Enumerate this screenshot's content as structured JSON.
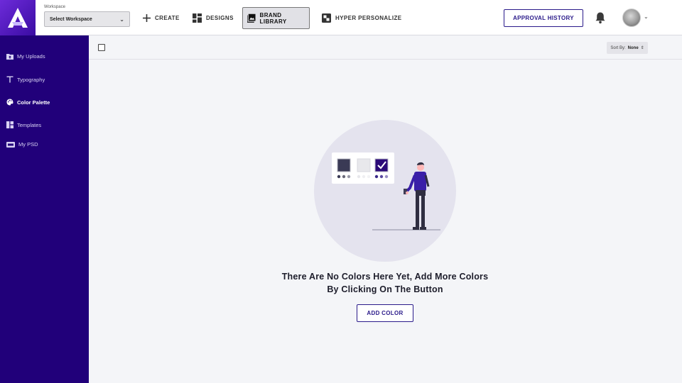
{
  "header": {
    "workspace_label": "Workspace",
    "workspace_value": "Select Workspace",
    "nav": [
      {
        "label": "CREATE",
        "icon": "plus-icon"
      },
      {
        "label": "DESIGNS",
        "icon": "grid-icon"
      },
      {
        "label": "BRAND LIBRARY",
        "icon": "image-icon",
        "active": true
      },
      {
        "label": "HYPER PERSONALIZE",
        "icon": "personalize-icon"
      }
    ],
    "approval_label": "APPROVAL HISTORY"
  },
  "sidebar": {
    "items": [
      {
        "label": "My Uploads",
        "icon": "upload-folder-icon"
      },
      {
        "label": "Typography",
        "icon": "typography-icon"
      },
      {
        "label": "Color Palette",
        "icon": "palette-icon",
        "active": true
      },
      {
        "label": "Templates",
        "icon": "templates-icon"
      },
      {
        "label": "My PSD",
        "icon": "psd-icon"
      }
    ]
  },
  "toolbar": {
    "sort_label": "Sort By:",
    "sort_value": "None"
  },
  "empty_state": {
    "line1": "There Are No Colors Here Yet, Add More Colors",
    "line2": "By Clicking On The Button",
    "button_label": "ADD COLOR"
  },
  "colors": {
    "sidebar_bg": "#21007a",
    "accent": "#2a1a8a",
    "page_bg": "#f4f5f8"
  }
}
